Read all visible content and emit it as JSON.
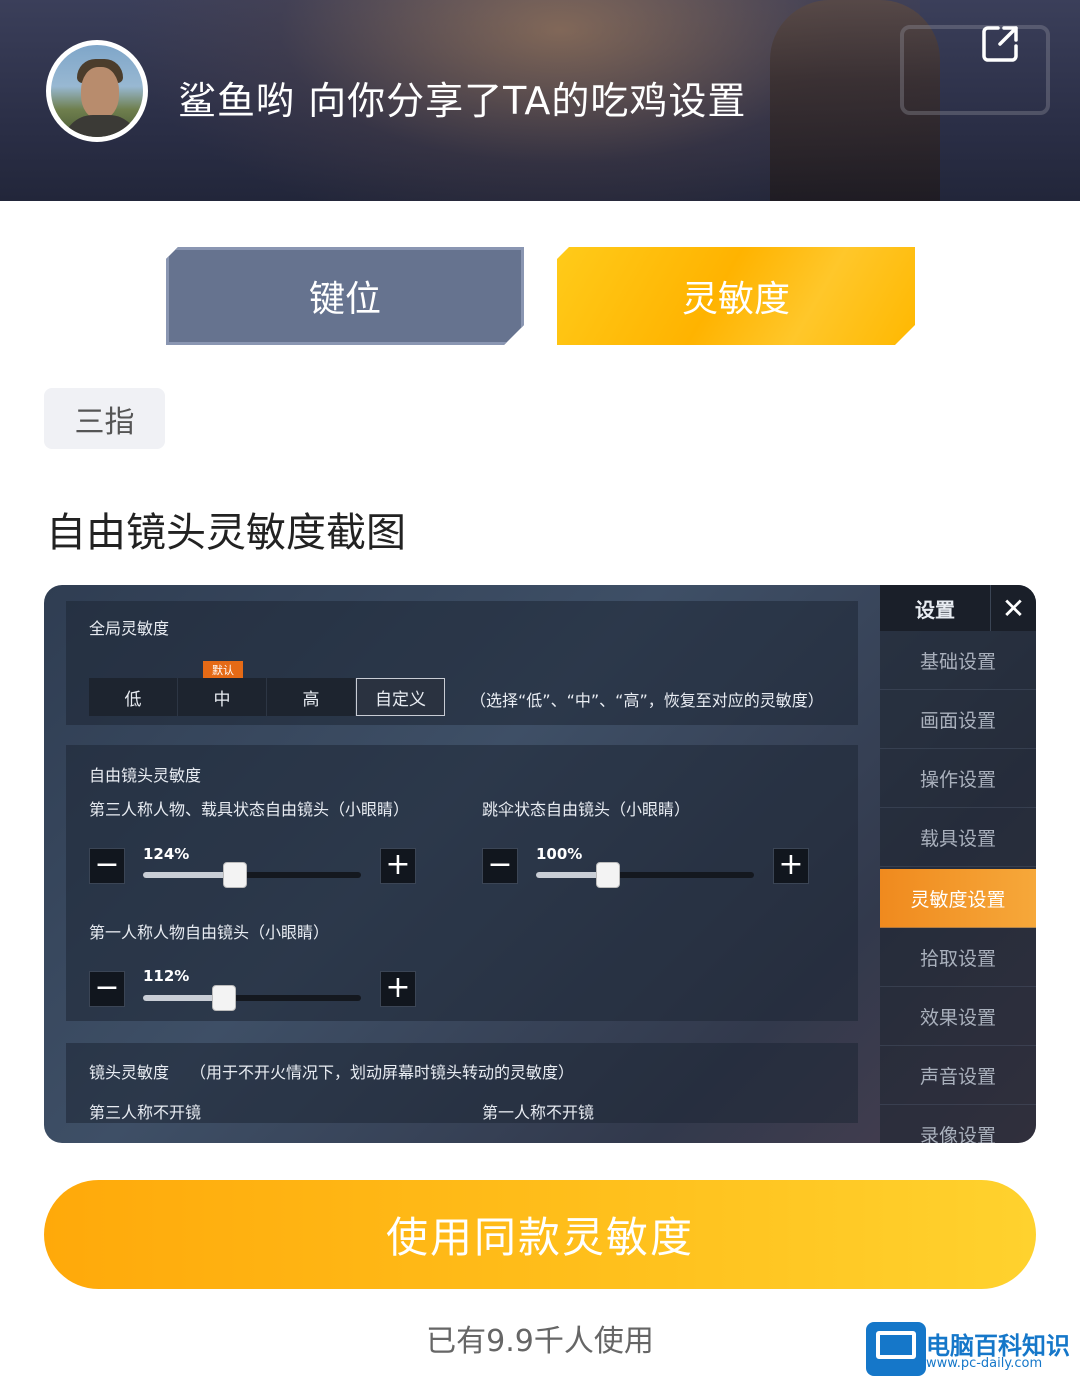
{
  "header": {
    "title": "鲨鱼哟 向你分享了TA的吃鸡设置",
    "share_icon": "share-icon"
  },
  "tabs": [
    {
      "label": "键位",
      "active": false
    },
    {
      "label": "灵敏度",
      "active": true
    }
  ],
  "mode_chip": "三指",
  "section_title": "自由镜头灵敏度截图",
  "screenshot": {
    "global": {
      "label": "全局灵敏度",
      "default_badge": "默认",
      "options": [
        "低",
        "中",
        "高",
        "自定义"
      ],
      "selected": "自定义",
      "note": "（选择“低”、“中”、“高”，恢复至对应的灵敏度）"
    },
    "free_camera": {
      "label": "自由镜头灵敏度",
      "sliders": [
        {
          "label": "第三人称人物、载具状态自由镜头（小眼睛）",
          "value": "124%"
        },
        {
          "label": "跳伞状态自由镜头（小眼睛）",
          "value": "100%"
        },
        {
          "label": "第一人称人物自由镜头（小眼睛）",
          "value": "112%"
        }
      ]
    },
    "camera": {
      "label": "镜头灵敏度",
      "note": "（用于不开火情况下，划动屏幕时镜头转动的灵敏度）",
      "left": "第三人称不开镜",
      "right": "第一人称不开镜"
    },
    "menu": {
      "title": "设置",
      "items": [
        "基础设置",
        "画面设置",
        "操作设置",
        "载具设置",
        "灵敏度设置",
        "拾取设置",
        "效果设置",
        "声音设置",
        "录像设置"
      ],
      "active": "灵敏度设置"
    },
    "slider_positions": [
      0.42,
      0.33,
      0.37
    ],
    "minus": "−",
    "plus": "+"
  },
  "cta": {
    "label": "使用同款灵敏度"
  },
  "usage": "已有9.9千人使用",
  "watermark": {
    "title": "电脑百科知识",
    "url": "www.pc-daily.com"
  },
  "colors": {
    "accent": "#ffb300",
    "tab_inactive": "#66738f",
    "menu_active": "#f08a1e"
  }
}
